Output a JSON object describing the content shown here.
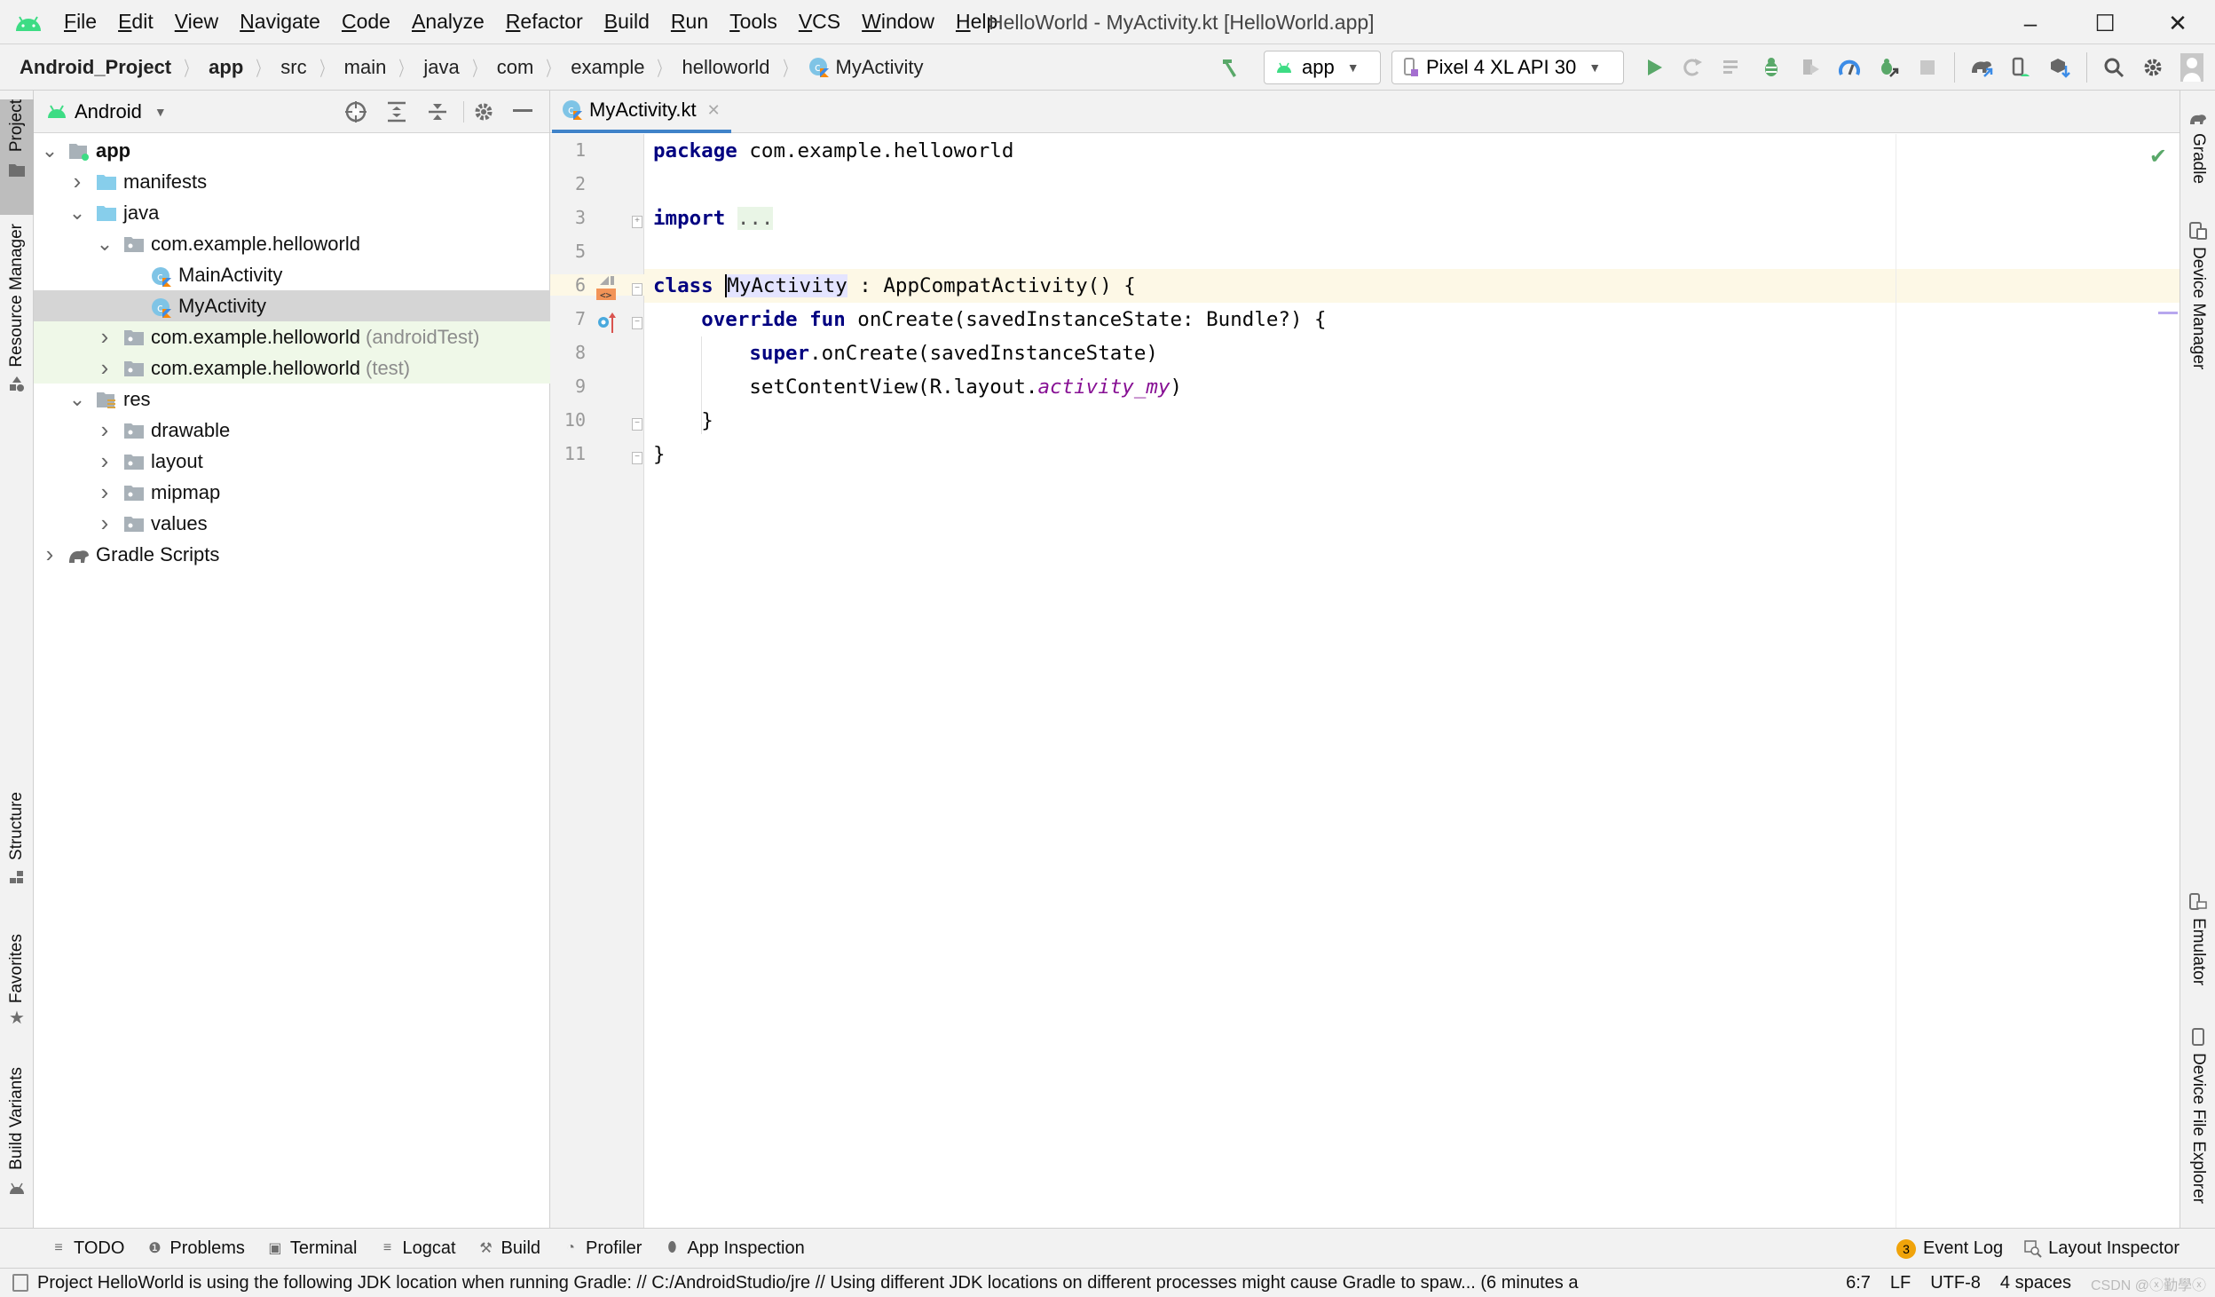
{
  "window": {
    "title": "HelloWorld - MyActivity.kt [HelloWorld.app]",
    "controls": {
      "minimize": "–",
      "maximize": "☐",
      "close": "✕"
    }
  },
  "menu": [
    "File",
    "Edit",
    "View",
    "Navigate",
    "Code",
    "Analyze",
    "Refactor",
    "Build",
    "Run",
    "Tools",
    "VCS",
    "Window",
    "Help"
  ],
  "breadcrumb": [
    {
      "label": "Android_Project",
      "bold": true
    },
    {
      "label": "app",
      "bold": true
    },
    {
      "label": "src"
    },
    {
      "label": "main"
    },
    {
      "label": "java"
    },
    {
      "label": "com"
    },
    {
      "label": "example"
    },
    {
      "label": "helloworld"
    },
    {
      "label": "MyActivity",
      "icon": "kotlin-class-icon"
    }
  ],
  "toolbar": {
    "run_config": "app",
    "device": "Pixel 4 XL API 30",
    "icons": [
      "build-hammer-icon",
      "run-icon",
      "apply-changes-icon",
      "apply-code-changes-icon",
      "debug-icon",
      "run-coverage-icon",
      "profile-icon",
      "attach-debugger-icon",
      "stop-icon",
      "sync-gradle-icon",
      "avd-manager-icon",
      "sdk-manager-icon",
      "search-icon",
      "settings-icon",
      "account-icon"
    ]
  },
  "left_stripe": {
    "tabs": [
      {
        "label": "Project",
        "active": true
      },
      {
        "label": "Resource Manager"
      },
      {
        "label": "Structure"
      },
      {
        "label": "Favorites"
      },
      {
        "label": "Build Variants"
      }
    ]
  },
  "right_stripe": {
    "tabs": [
      {
        "label": "Gradle"
      },
      {
        "label": "Device Manager"
      },
      {
        "label": "Emulator"
      },
      {
        "label": "Device File Explorer"
      }
    ]
  },
  "project_panel": {
    "view": "Android",
    "tree": [
      {
        "label": "app",
        "bold": true,
        "expanded": true,
        "icon": "module-folder"
      },
      {
        "label": "manifests",
        "expanded": false,
        "icon": "folder-blue"
      },
      {
        "label": "java",
        "expanded": true,
        "icon": "folder-blue"
      },
      {
        "label": "com.example.helloworld",
        "expanded": true,
        "icon": "package"
      },
      {
        "label": "MainActivity",
        "icon": "kotlin-class"
      },
      {
        "label": "MyActivity",
        "icon": "kotlin-class",
        "selected": true
      },
      {
        "label": "com.example.helloworld",
        "suffix": "(androidTest)",
        "expanded": false,
        "icon": "package",
        "test": true
      },
      {
        "label": "com.example.helloworld",
        "suffix": "(test)",
        "expanded": false,
        "icon": "package",
        "test": true
      },
      {
        "label": "res",
        "expanded": true,
        "icon": "res-folder"
      },
      {
        "label": "drawable",
        "expanded": false,
        "icon": "package"
      },
      {
        "label": "layout",
        "expanded": false,
        "icon": "package"
      },
      {
        "label": "mipmap",
        "expanded": false,
        "icon": "package"
      },
      {
        "label": "values",
        "expanded": false,
        "icon": "package"
      },
      {
        "label": "Gradle Scripts",
        "expanded": false,
        "icon": "gradle"
      }
    ]
  },
  "editor": {
    "tab": "MyActivity.kt",
    "line_numbers": [
      "1",
      "2",
      "3",
      "5",
      "6",
      "7",
      "8",
      "9",
      "10",
      "11"
    ],
    "code": {
      "l1_kw": "package",
      "l1_rest": " com.example.helloworld",
      "l3_kw": "import",
      "l3_fold": "...",
      "l6_kw": "class",
      "l6_name": "MyActivity",
      "l6_rest": " : AppCompatActivity() {",
      "l7_kw1": "override",
      "l7_kw2": "fun",
      "l7_rest": " onCreate(savedInstanceState: Bundle?) {",
      "l8_kw": "super",
      "l8_rest": ".onCreate(savedInstanceState)",
      "l9_pre": "setContentView(R.layout.",
      "l9_field": "activity_my",
      "l9_post": ")",
      "l10": "}",
      "l11": "}"
    }
  },
  "bottom_bar": {
    "tabs": [
      {
        "label": "TODO",
        "icon": "≡"
      },
      {
        "label": "Problems",
        "icon": "❶"
      },
      {
        "label": "Terminal",
        "icon": "▣"
      },
      {
        "label": "Logcat",
        "icon": "≡"
      },
      {
        "label": "Build",
        "icon": "⚒"
      },
      {
        "label": "Profiler",
        "icon": "◔"
      },
      {
        "label": "App Inspection",
        "icon": "⬮"
      }
    ],
    "event_log": {
      "label": "Event Log",
      "count": "3"
    },
    "layout_inspector": "Layout Inspector"
  },
  "status_bar": {
    "message": "Project HelloWorld is using the following JDK location when running Gradle: // C:/AndroidStudio/jre // Using different JDK locations on different processes might cause Gradle to spaw... (6 minutes a",
    "position": "6:7",
    "line_sep": "LF",
    "encoding": "UTF-8",
    "indent": "4 spaces",
    "watermark": "CSDN @ⓧ勤學ⓧ"
  },
  "colors": {
    "accent": "#4083c9",
    "keyword": "#0033b3",
    "field": "#871094",
    "android_green": "#3ddc84",
    "run_green": "#59a869",
    "selection": "#d5d5d5",
    "test_bg": "#eff8e8",
    "current_line": "#fdf8e6"
  }
}
